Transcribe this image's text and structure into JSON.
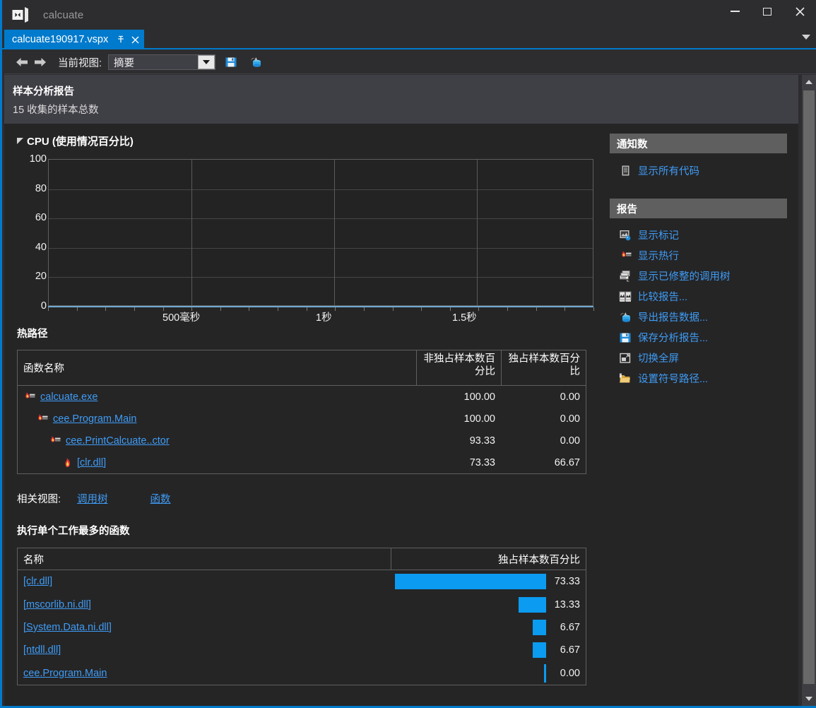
{
  "window": {
    "app_title": "calcuate",
    "logo_icon": "visual-studio-logo",
    "minimize_label": "−",
    "maximize_label": "□",
    "close_label": "✕"
  },
  "tab": {
    "label": "calcuate190917.vspx",
    "pin_icon": "pin-icon",
    "close_icon": "close-icon",
    "list_chevron_icon": "chevron-down-icon"
  },
  "toolbar": {
    "back_icon": "arrow-left-icon",
    "forward_icon": "arrow-right-icon",
    "view_label": "当前视图:",
    "view_value": "摘要",
    "dropdown_icon": "chevron-down-icon",
    "save_icon": "save-icon",
    "export_icon": "export-data-icon"
  },
  "report_header": {
    "title": "样本分析报告",
    "subtitle": "15 收集的样本总数"
  },
  "cpu_section": {
    "collapse_icon": "triangle-collapse-icon",
    "title": "CPU (使用情况百分比)"
  },
  "chart_data": {
    "type": "line",
    "title": "CPU (使用情况百分比)",
    "xlabel": "",
    "ylabel": "",
    "ylim": [
      0,
      100
    ],
    "yticks": [
      0,
      20,
      40,
      60,
      80,
      100
    ],
    "ytick_labels": [
      "0",
      "20",
      "40",
      "60",
      "80",
      "100"
    ],
    "xticks": [
      500,
      1000,
      1500
    ],
    "xtick_labels": [
      "500毫秒",
      "1秒",
      "1.5秒"
    ],
    "xlim": [
      0,
      1900
    ],
    "series": [
      {
        "name": "CPU",
        "x": [],
        "values": []
      }
    ],
    "grid": true,
    "legend": "none",
    "note": "空图，无数据描绘"
  },
  "hotpath": {
    "title": "热路径",
    "columns": [
      "函数名称",
      "非独占样本数百分比",
      "独占样本数百分比"
    ],
    "rows": [
      {
        "icon": "flame-bar-icon",
        "indent": 0,
        "name": "calcuate.exe",
        "inclusive": "100.00",
        "exclusive": "0.00"
      },
      {
        "icon": "flame-bar-icon",
        "indent": 1,
        "name": "cee.Program.Main",
        "inclusive": "100.00",
        "exclusive": "0.00"
      },
      {
        "icon": "flame-bar-icon",
        "indent": 2,
        "name": "cee.PrintCalcuate..ctor",
        "inclusive": "93.33",
        "exclusive": "0.00"
      },
      {
        "icon": "flame-icon",
        "indent": 3,
        "name": "[clr.dll]",
        "inclusive": "73.33",
        "exclusive": "66.67"
      }
    ]
  },
  "related_views": {
    "label": "相关视图:",
    "links": [
      "调用树",
      "函数"
    ]
  },
  "top_functions": {
    "title": "执行单个工作最多的函数",
    "columns": [
      "名称",
      "独占样本数百分比"
    ],
    "chart_max": 73.33,
    "rows": [
      {
        "name": "[clr.dll]",
        "value": "73.33",
        "pct": 73.33
      },
      {
        "name": "[mscorlib.ni.dll]",
        "value": "13.33",
        "pct": 13.33
      },
      {
        "name": "[System.Data.ni.dll]",
        "value": "6.67",
        "pct": 6.67
      },
      {
        "name": "[ntdll.dll]",
        "value": "6.67",
        "pct": 6.67
      },
      {
        "name": "cee.Program.Main",
        "value": "0.00",
        "pct": 0
      }
    ]
  },
  "sidebar": {
    "panels": [
      {
        "title": "通知数",
        "items": [
          {
            "icon": "document-icon",
            "label": "显示所有代码"
          }
        ]
      },
      {
        "title": "报告",
        "items": [
          {
            "icon": "marks-icon",
            "label": "显示标记"
          },
          {
            "icon": "flame-bar-icon",
            "label": "显示热行"
          },
          {
            "icon": "call-tree-icon",
            "label": "显示已修整的调用树"
          },
          {
            "icon": "compare-report-icon",
            "label": "比较报告..."
          },
          {
            "icon": "export-data-icon",
            "label": "导出报告数据..."
          },
          {
            "icon": "save-icon",
            "label": "保存分析报告..."
          },
          {
            "icon": "fullscreen-icon",
            "label": "切换全屏"
          },
          {
            "icon": "symbol-path-icon",
            "label": "设置符号路径..."
          }
        ]
      }
    ]
  },
  "scrollbar": {
    "up_icon": "chevron-up-icon",
    "down_icon": "chevron-down-icon"
  },
  "colors": {
    "accent": "#007acc",
    "link": "#3f9cf5",
    "bar": "#0b9bf0",
    "window_bg": "#2d2d30",
    "content_bg": "#252526",
    "panel_head": "#5f5f5f"
  }
}
